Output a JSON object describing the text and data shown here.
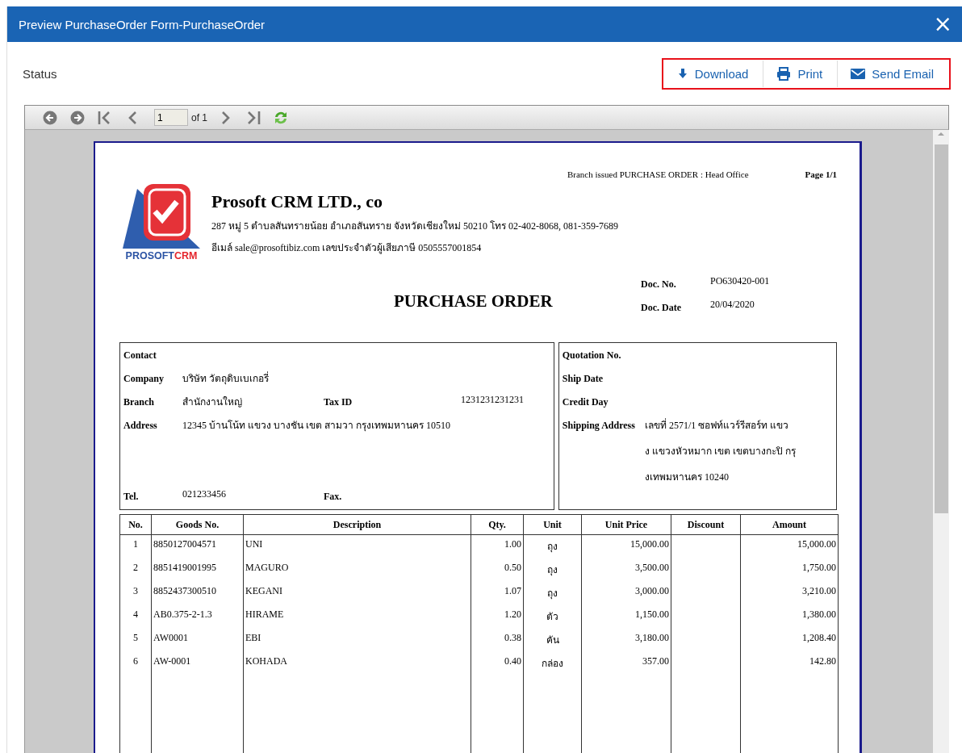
{
  "window": {
    "title": "Preview PurchaseOrder Form-PurchaseOrder",
    "close": "×"
  },
  "status_label": "Status",
  "actions": [
    {
      "label": "Download"
    },
    {
      "label": "Print"
    },
    {
      "label": "Send Email"
    }
  ],
  "viewer": {
    "page_value": "1",
    "page_count": "of 1"
  },
  "document": {
    "branch_issued": "Branch issued PURCHASE ORDER : Head Office",
    "page": "Page 1/1",
    "logo_text": [
      "PROSOFT",
      "CRM"
    ],
    "company_name": "Prosoft CRM LTD., co",
    "address_line": "287 หมู่ 5 ตำบลสันทรายน้อย อำเภอสันทราย จังหวัดเชียงใหม่ 50210 โทร 02-402-8068, 081-359-7689",
    "email_line": "อีเมล์ sale@prosoftibiz.com เลขประจำตัวผู้เสียภาษี 0505557001854",
    "title": "PURCHASE ORDER",
    "doc_no": {
      "label": "Doc. No.",
      "value": "PO630420-001"
    },
    "doc_date": {
      "label": "Doc. Date",
      "value": "20/04/2020"
    },
    "buyer": {
      "contact": {
        "label": "Contact"
      },
      "company": {
        "label": "Company",
        "value": "บริษัท วัตถุดิบเบเกอรี่"
      },
      "branch": {
        "label": "Branch",
        "value": "สำนักงานใหญ่"
      },
      "tax_id": {
        "label": "Tax ID",
        "value": "1231231231231"
      },
      "address": {
        "label": "Address",
        "value": "12345 บ้านโน้ท แขวง บางชัน เขต สามวา กรุงเทพมหานคร 10510"
      },
      "tel": {
        "label": "Tel.",
        "value": "021233456"
      },
      "fax": {
        "label": "Fax."
      }
    },
    "shipping": {
      "quotation": {
        "label": "Quotation No."
      },
      "ship_date": {
        "label": "Ship Date"
      },
      "credit_day": {
        "label": "Credit Day"
      },
      "address": {
        "label": "Shipping Address",
        "lines": [
          "เลขที่ 2571/1 ซอฟท์แวร์รีสอร์ท แขว",
          "ง แขวงหัวหมาก เขต เขตบางกะปิ กรุ",
          "งเทพมหานคร 10240"
        ]
      }
    },
    "table": {
      "columns": [
        "No.",
        "Goods No.",
        "Description",
        "Qty.",
        "Unit",
        "Unit Price",
        "Discount",
        "Amount"
      ],
      "rows": [
        [
          "1",
          "8850127004571",
          "UNI",
          "1.00",
          "ถุง",
          "15,000.00",
          "",
          "15,000.00"
        ],
        [
          "2",
          "8851419001995",
          "MAGURO",
          "0.50",
          "ถุง",
          "3,500.00",
          "",
          "1,750.00"
        ],
        [
          "3",
          "8852437300510",
          "KEGANI",
          "1.07",
          "ถุง",
          "3,000.00",
          "",
          "3,210.00"
        ],
        [
          "4",
          "AB0.375-2-1.3",
          "HIRAME",
          "1.20",
          "ตัว",
          "1,150.00",
          "",
          "1,380.00"
        ],
        [
          "5",
          "AW0001",
          "EBI",
          "0.38",
          "คัน",
          "3,180.00",
          "",
          "1,208.40"
        ],
        [
          "6",
          "AW-0001",
          "KOHADA",
          "0.40",
          "กล่อง",
          "357.00",
          "",
          "142.80"
        ]
      ]
    }
  }
}
